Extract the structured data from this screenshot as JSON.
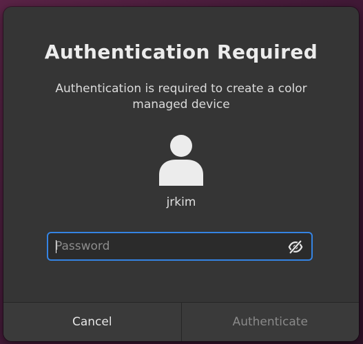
{
  "dialog": {
    "title": "Authentication Required",
    "message": "Authentication is required to create a color managed device",
    "user": {
      "name": "jrkim",
      "avatar_icon": "user-avatar-icon"
    },
    "password": {
      "placeholder": "Password",
      "value": "",
      "reveal_icon": "eye-slash-icon"
    },
    "buttons": {
      "cancel_label": "Cancel",
      "authenticate_label": "Authenticate"
    }
  },
  "colors": {
    "dialog_bg": "#353535",
    "focus_accent": "#3584e4",
    "text": "#ececec",
    "disabled_text": "#8a8a8a"
  }
}
